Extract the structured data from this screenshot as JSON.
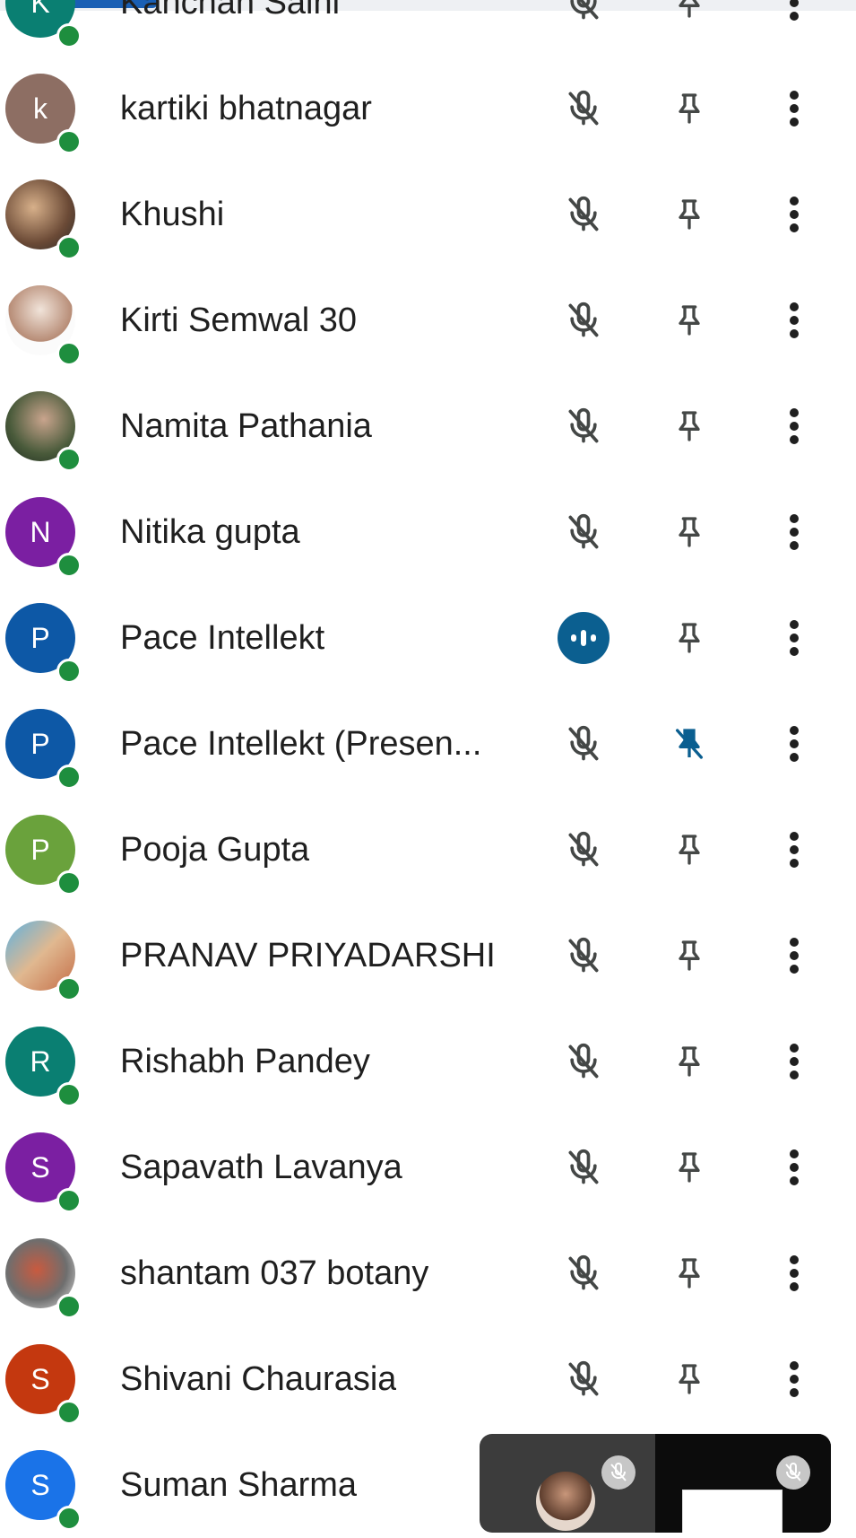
{
  "colors": {
    "presence": "#1e8e3e",
    "icon": "#444746",
    "speaking": "#0b5f90",
    "pinned": "#0b5f90"
  },
  "participants": [
    {
      "name": "Kanchan Saini",
      "initial": "K",
      "avatar_color": "#0a7f72",
      "mic": "muted",
      "pinned": false
    },
    {
      "name": "kartiki bhatnagar",
      "initial": "k",
      "avatar_color": "#8d6e63",
      "mic": "muted",
      "pinned": false
    },
    {
      "name": "Khushi",
      "initial": "",
      "avatar_photo": "photo",
      "mic": "muted",
      "pinned": false
    },
    {
      "name": "Kirti Semwal 30",
      "initial": "",
      "avatar_photo": "photo2",
      "mic": "muted",
      "pinned": false
    },
    {
      "name": "Namita Pathania",
      "initial": "",
      "avatar_photo": "photo3",
      "mic": "muted",
      "pinned": false
    },
    {
      "name": "Nitika gupta",
      "initial": "N",
      "avatar_color": "#7b1fa2",
      "mic": "muted",
      "pinned": false
    },
    {
      "name": "Pace Intellekt",
      "initial": "P",
      "avatar_color": "#0d58a6",
      "mic": "speaking",
      "pinned": false
    },
    {
      "name": "Pace Intellekt (Presen...",
      "initial": "P",
      "avatar_color": "#0d58a6",
      "mic": "muted",
      "pinned": true
    },
    {
      "name": "Pooja Gupta",
      "initial": "P",
      "avatar_color": "#6aa23c",
      "mic": "muted",
      "pinned": false
    },
    {
      "name": "PRANAV PRIYADARSHI",
      "initial": "",
      "avatar_photo": "photo4",
      "mic": "muted",
      "pinned": false
    },
    {
      "name": "Rishabh Pandey",
      "initial": "R",
      "avatar_color": "#0a7f72",
      "mic": "muted",
      "pinned": false
    },
    {
      "name": "Sapavath Lavanya",
      "initial": "S",
      "avatar_color": "#7b1fa2",
      "mic": "muted",
      "pinned": false
    },
    {
      "name": "shantam 037 botany",
      "initial": "",
      "avatar_photo": "photo5",
      "mic": "muted",
      "pinned": false
    },
    {
      "name": "Shivani Chaurasia",
      "initial": "S",
      "avatar_color": "#c4380f",
      "mic": "muted",
      "pinned": false
    },
    {
      "name": "Suman Sharma",
      "initial": "S",
      "avatar_color": "#1a73e8",
      "mic": "muted",
      "pinned": false
    }
  ],
  "pip": {
    "left_tile": "participant-camera",
    "right_tile": "screen-share"
  }
}
